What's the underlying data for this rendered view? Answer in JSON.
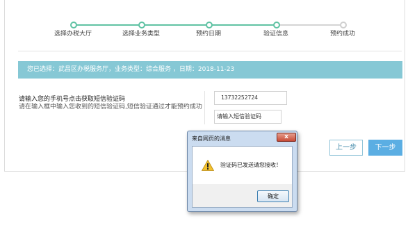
{
  "steps": [
    {
      "label": "选择办税大厅",
      "state": "done"
    },
    {
      "label": "选择业务类型",
      "state": "done"
    },
    {
      "label": "预约日期",
      "state": "done"
    },
    {
      "label": "验证信息",
      "state": "current"
    },
    {
      "label": "预约成功",
      "state": "pending"
    }
  ],
  "info_bar": "您已选择：武昌区办税服务厅，业务类型：综合服务 ，日期：2018-11-23",
  "instructions": {
    "title": "请输入您的手机号点击获取短信验证码",
    "text": "请在输入框中输入您收到的短信验证码,短信验证通过才能预约成功"
  },
  "form": {
    "phone_value": "13732252724",
    "code_placeholder": "请输入短信验证码"
  },
  "buttons": {
    "prev": "上一步",
    "next": "下一步"
  },
  "dialog": {
    "title": "来自网页的消息",
    "close": "x",
    "message": "验证码已发送请您接收！",
    "ok": "确定",
    "icon": "warning-icon"
  },
  "colors": {
    "step_done": "#5fc2a3",
    "step_pending": "#cfcfcf",
    "info_bar_bg": "#86c8d5",
    "next_button": "#5baee3"
  }
}
